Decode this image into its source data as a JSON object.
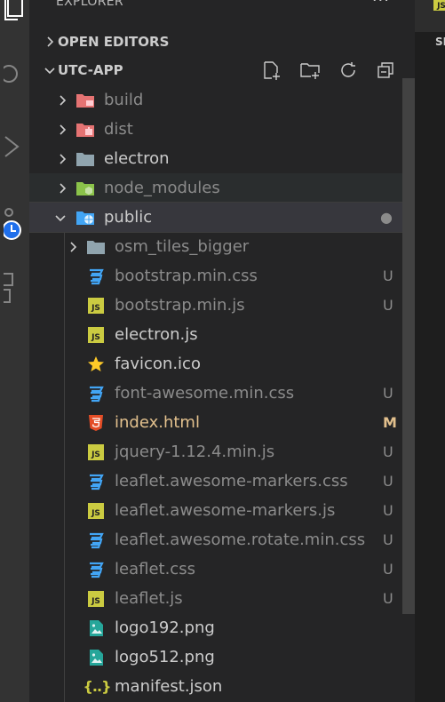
{
  "panel": {
    "title": "EXPLORER",
    "more": "···"
  },
  "sections": {
    "open_editors": "OPEN EDITORS",
    "project": "UTC-APP"
  },
  "tree": [
    {
      "name": "build",
      "status": "",
      "kind": "folder"
    },
    {
      "name": "dist",
      "status": "",
      "kind": "folder"
    },
    {
      "name": "electron",
      "status": "",
      "kind": "folder"
    },
    {
      "name": "node_modules",
      "status": "",
      "kind": "folder"
    },
    {
      "name": "public",
      "status": "●",
      "kind": "folder"
    },
    {
      "name": "osm_tiles_bigger",
      "status": "",
      "kind": "folder"
    },
    {
      "name": "bootstrap.min.css",
      "status": "U",
      "kind": "css"
    },
    {
      "name": "bootstrap.min.js",
      "status": "U",
      "kind": "js"
    },
    {
      "name": "electron.js",
      "status": "",
      "kind": "js"
    },
    {
      "name": "favicon.ico",
      "status": "",
      "kind": "ico"
    },
    {
      "name": "font-awesome.min.css",
      "status": "U",
      "kind": "css"
    },
    {
      "name": "index.html",
      "status": "M",
      "kind": "html"
    },
    {
      "name": "jquery-1.12.4.min.js",
      "status": "U",
      "kind": "js"
    },
    {
      "name": "leaflet.awesome-markers.css",
      "status": "U",
      "kind": "css"
    },
    {
      "name": "leaflet.awesome-markers.js",
      "status": "U",
      "kind": "js"
    },
    {
      "name": "leaflet.awesome.rotate.min.css",
      "status": "U",
      "kind": "css"
    },
    {
      "name": "leaflet.css",
      "status": "U",
      "kind": "css"
    },
    {
      "name": "leaflet.js",
      "status": "U",
      "kind": "js"
    },
    {
      "name": "logo192.png",
      "status": "",
      "kind": "png"
    },
    {
      "name": "logo512.png",
      "status": "",
      "kind": "png"
    },
    {
      "name": "manifest.json",
      "status": "",
      "kind": "json"
    }
  ],
  "icons": {
    "js_label": "JS",
    "json_label": "{..}"
  },
  "editor": {
    "tab_label": "JS",
    "breadcrumb": "SI"
  },
  "colors": {
    "modified": "#e2c08d",
    "untracked": "#8b8b8b",
    "js": "#cbcb41",
    "css": "#42a5f5",
    "html": "#e44d26",
    "folder_special": "#e57373",
    "node": "#8bc34a"
  }
}
